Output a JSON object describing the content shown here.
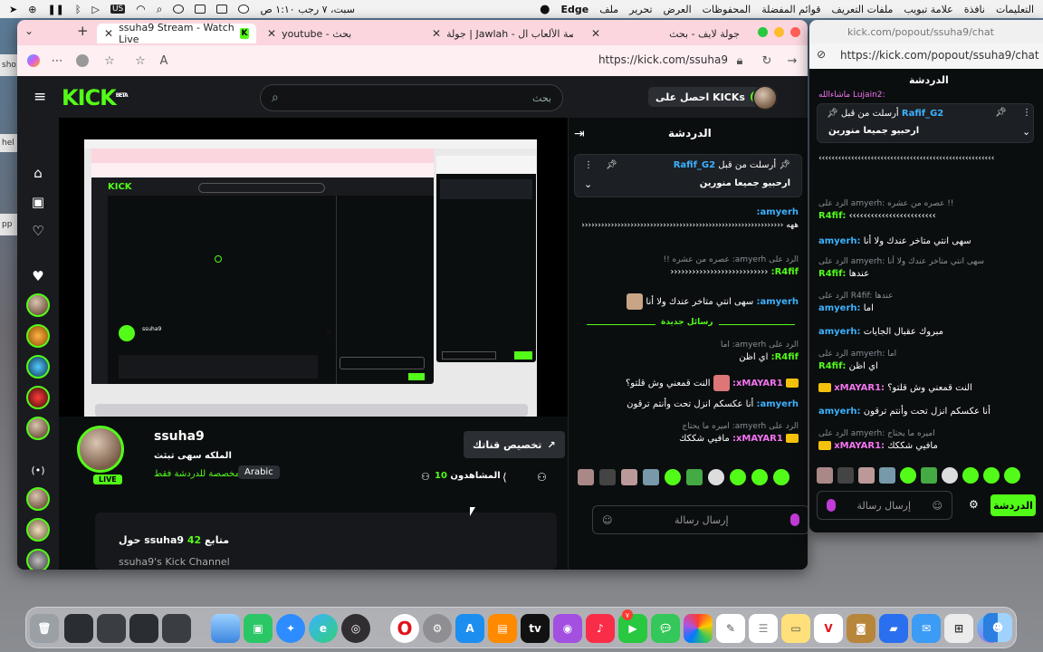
{
  "menubar": {
    "left_items": [
      "Edge",
      "ملف",
      "تحرير",
      "العرض",
      "المحفوظات",
      "قوائم المفضلة",
      "ملفات التعريف",
      "علامة تبويب",
      "نافذة",
      "التعليمات"
    ],
    "clock": "سبت، ٧ رجب  ١:١٠ ص",
    "us_label": "US"
  },
  "desktop": {
    "left_fragments": [
      "sho",
      "hel",
      "pp"
    ]
  },
  "browser": {
    "tabs": [
      {
        "label": "جولة لايف - بحث"
      },
      {
        "label": "جولة | Jawlah - منصة الألعاب ال"
      },
      {
        "label": "youtube - بحث"
      },
      {
        "label": "ssuha9 Stream - Watch Live"
      }
    ],
    "url": "https://kick.com/ssuha9"
  },
  "kick": {
    "logo": "KICK",
    "logo_beta": "BETA",
    "search_placeholder": "بحث",
    "get_kicks": "احصل على KICKs",
    "chat_title": "الدردشة"
  },
  "stream": {
    "username": "ssuha9",
    "title": "الملكه سهى تبثث",
    "category": "مخصصة للدردشة فقط",
    "language": "Arabic",
    "live": "LIVE",
    "viewers_label": "المشاهدون",
    "viewers": "10",
    "customize_button": "تخصيص قناتك",
    "about_title": "حول ssuha9",
    "followers": "42",
    "followers_label": "متابع",
    "about_text": "ssuha9's Kick Channel"
  },
  "pinned": {
    "label": "أرسلت من قبل",
    "author": "Rafif_G2",
    "text": "ارحبيو جميعا منورين"
  },
  "chat": {
    "messages": [
      {
        "user": "amyerh:",
        "text": "ههه ‹‹‹‹‹‹‹‹‹‹‹‹‹‹‹‹‹‹‹‹‹‹‹‹‹‹‹‹‹‹‹‹‹‹‹‹‹‹‹‹‹‹‹‹‹‹‹‹‹‹‹‹‹‹‹‹‹‹‹‹‹‹"
      },
      {
        "reply": "الرد على amyerh: عصره من عشره !!",
        "user": "R4fif:",
        "text": "‹‹‹‹‹‹‹‹‹‹‹‹‹‹‹‹‹‹‹‹‹‹‹‹‹‹‹"
      },
      {
        "user": "amyerh:",
        "text": "سهى انتي متاخر عندك ولا أنا"
      },
      {
        "divider": "رسائل جديدة"
      },
      {
        "reply": "الرد على amyerh: اما",
        "user": "R4fif:",
        "text": "اي اظن"
      },
      {
        "user": "xMAYAR1:",
        "text": "النت قمعني وش قلتو؟"
      },
      {
        "user": "amyerh:",
        "text": "أنا عكسكم انزل تحت وأنتم ترقون"
      },
      {
        "reply": "الرد على amyerh: اميره ما يحتاج",
        "user": "xMAYAR1:",
        "text": "مافيي شككك"
      }
    ],
    "input_placeholder": "إرسال رسالة",
    "send_button": "الدردشة"
  },
  "popout": {
    "title": "kick.com/popout/ssuha9/chat",
    "url": "https://kick.com/popout/ssuha9/chat",
    "chat_title": "الدردشة",
    "messages": [
      {
        "text": "‹‹‹‹‹‹‹‹‹‹‹‹‹‹‹‹‹‹‹‹‹‹‹‹‹‹‹‹‹‹‹‹‹‹‹‹‹‹‹‹‹‹‹‹‹‹‹‹‹‹‹‹‹‹"
      },
      {
        "reply": "الرد على amyerh: عصره من عشره !!",
        "user": "R4fif:",
        "text": "‹‹‹‹‹‹‹‹‹‹‹‹‹‹‹‹‹‹‹‹‹‹‹‹"
      },
      {
        "user": "amyerh:",
        "text": "سهى انتي متاخر عندك ولا أنا"
      },
      {
        "reply": "الرد على amyerh: سهى انتي متاخر عندك ولا أنا",
        "user": "R4fif:",
        "text": "عندها"
      },
      {
        "reply": "الرد على R4fif: عندها",
        "user": "amyerh:",
        "text": "اما"
      },
      {
        "user": "amyerh:",
        "text": "مبروك عقبال الجايات"
      },
      {
        "reply": "الرد على amyerh: اما",
        "user": "R4fif:",
        "text": "اي اظن"
      },
      {
        "user": "xMAYAR1:",
        "text": "النت قمعني وش قلتو؟"
      },
      {
        "user": "amyerh:",
        "text": "أنا عكسكم انزل تحت وأنتم ترقون"
      },
      {
        "reply": "الرد على amyerh: اميره ما يحتاج",
        "user": "xMAYAR1:",
        "text": "مافيي شككك"
      }
    ],
    "top_fragment": "ماشاءالله  Lujain2:"
  },
  "colors": {
    "kick_green": "#53fc18",
    "chat_user_blue": "#3db2ff",
    "crown_gold": "#f4c20d"
  },
  "dock": {
    "items": [
      "trash",
      "screenshots",
      "finder",
      "messages-pink",
      "safari",
      "edge",
      "obs",
      "opera",
      "settings",
      "app-store",
      "books",
      "apple-tv",
      "podcasts",
      "music",
      "facetime",
      "messages",
      "photos",
      "freeform",
      "notes",
      "reminders",
      "calendar",
      "contacts",
      "keynote",
      "mail",
      "launchpad",
      "siri",
      "finder-face"
    ],
    "tv_label": "tv",
    "badge": "٧"
  }
}
